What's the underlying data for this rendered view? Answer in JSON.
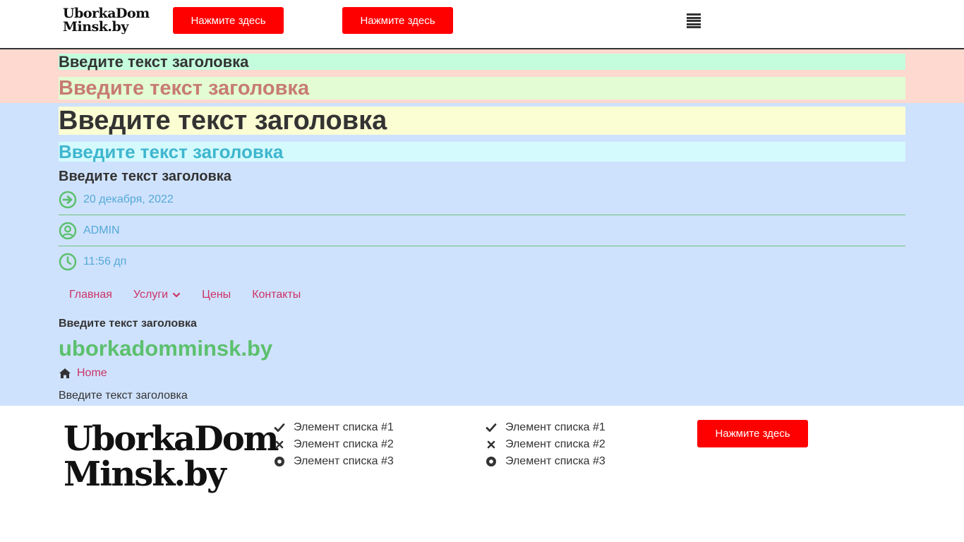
{
  "header": {
    "logo": "UborkaDom Minsk.by",
    "button1_label": "Нажмите здесь",
    "button2_label": "Нажмите здесь"
  },
  "headings": {
    "h1": "Введите текст заголовка",
    "h2": "Введите текст заголовка",
    "h3": "Введите текст заголовка",
    "h4": "Введите текст заголовка",
    "h5": "Введите текст заголовка"
  },
  "meta": {
    "date": "20 декабря, 2022",
    "author": "ADMIN",
    "time": "11:56 дп"
  },
  "nav": {
    "items": [
      {
        "label": "Главная"
      },
      {
        "label": "Услуги"
      },
      {
        "label": "Цены"
      },
      {
        "label": "Контакты"
      }
    ]
  },
  "content": {
    "small_heading": "Введите текст заголовка",
    "site_title": "uborkadomminsk.by",
    "breadcrumb": "Home",
    "plain_heading": "Введите текст заголовка"
  },
  "footer": {
    "logo": "UborkaDom Minsk.by",
    "list1": [
      {
        "label": "Элемент списка #1",
        "icon": "check-icon"
      },
      {
        "label": "Элемент списка #2",
        "icon": "times-icon"
      },
      {
        "label": "Элемент списка #3",
        "icon": "dot-circle-icon"
      }
    ],
    "list2": [
      {
        "label": "Элемент списка #1",
        "icon": "check-icon"
      },
      {
        "label": "Элемент списка #2",
        "icon": "times-icon"
      },
      {
        "label": "Элемент списка #3",
        "icon": "dot-circle-icon"
      }
    ],
    "button_label": "Нажмите здесь"
  },
  "colors": {
    "accent_red": "#ff0000",
    "link_pink": "#cc3366",
    "meta_blue": "#54a8d8",
    "icon_green": "#5cc06e",
    "title_green": "#5cc06e"
  }
}
